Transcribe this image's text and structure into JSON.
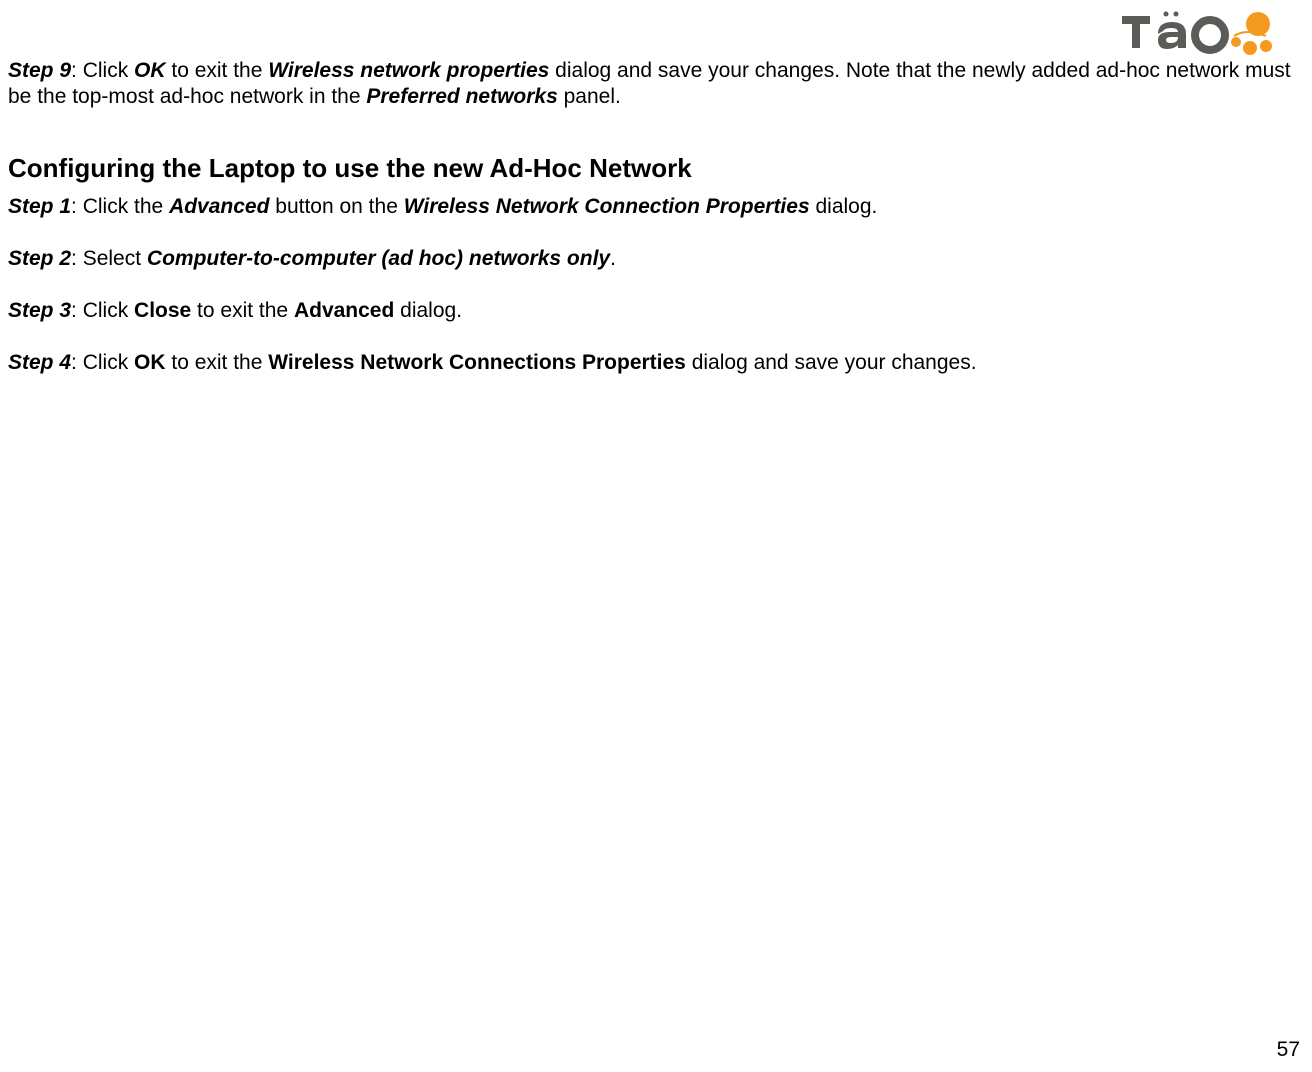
{
  "logo": {
    "text": "Tao",
    "accent": "#f39a1f",
    "text_color": "#5b5b58"
  },
  "step9": {
    "label": "Step 9",
    "parts": [
      ": Click ",
      "OK",
      " to exit the ",
      "Wireless network properties",
      " dialog and save your changes.  Note that the newly added ad-hoc network must be the top-most ad-hoc network in the ",
      "Preferred networks",
      " panel."
    ]
  },
  "section_title": "Configuring the Laptop to use the new Ad-Hoc Network",
  "step1": {
    "label": "Step 1",
    "parts": [
      ": Click the ",
      "Advanced",
      " button on the ",
      "Wireless Network Connection Properties",
      " dialog."
    ]
  },
  "step2": {
    "label": "Step 2",
    "parts": [
      ": Select ",
      "Computer-to-computer (ad hoc) networks only",
      "."
    ]
  },
  "step3": {
    "label": "Step 3",
    "parts": [
      ": Click ",
      "Close",
      " to exit the ",
      "Advanced",
      " dialog."
    ]
  },
  "step4": {
    "label": "Step 4",
    "parts": [
      ": Click ",
      "OK",
      " to exit the ",
      "Wireless Network Connections Properties",
      " dialog and save your changes."
    ]
  },
  "page_number": "57"
}
